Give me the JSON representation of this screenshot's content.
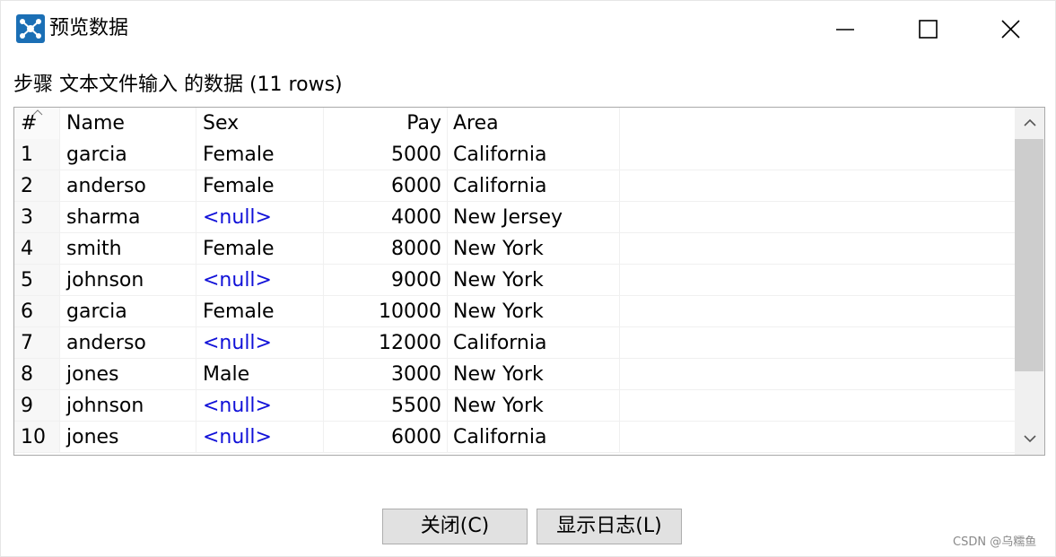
{
  "window": {
    "title": "预览数据",
    "heading": "步骤 文本文件输入 的数据  (11 rows)"
  },
  "icons": {
    "app": "network-nodes-icon",
    "minimize": "minimize-icon",
    "maximize": "maximize-icon",
    "close": "close-icon",
    "sort": "sort-caret-icon",
    "scroll_up": "chevron-up-icon",
    "scroll_down": "chevron-down-icon"
  },
  "colors": {
    "null_text": "#1010d8",
    "app_icon": "#1b6fb5"
  },
  "table": {
    "columns": [
      "#",
      "Name",
      "Sex",
      "Pay",
      "Area"
    ],
    "rows": [
      [
        "1",
        "garcia",
        "Female",
        "5000",
        "California"
      ],
      [
        "2",
        "anderso",
        "Female",
        "6000",
        "California"
      ],
      [
        "3",
        "sharma",
        "<null>",
        "4000",
        "New Jersey"
      ],
      [
        "4",
        "smith",
        "Female",
        "8000",
        "New York"
      ],
      [
        "5",
        "johnson",
        "<null>",
        "9000",
        "New York"
      ],
      [
        "6",
        "garcia",
        "Female",
        "10000",
        "New York"
      ],
      [
        "7",
        "anderso",
        "<null>",
        "12000",
        "California"
      ],
      [
        "8",
        "jones",
        "Male",
        "3000",
        "New York"
      ],
      [
        "9",
        "johnson",
        "<null>",
        "5500",
        "New York"
      ],
      [
        "10",
        "jones",
        "<null>",
        "6000",
        "California"
      ]
    ]
  },
  "buttons": {
    "close": "关闭(C)",
    "show_log": "显示日志(L)"
  },
  "watermark": "CSDN @乌糯鱼"
}
